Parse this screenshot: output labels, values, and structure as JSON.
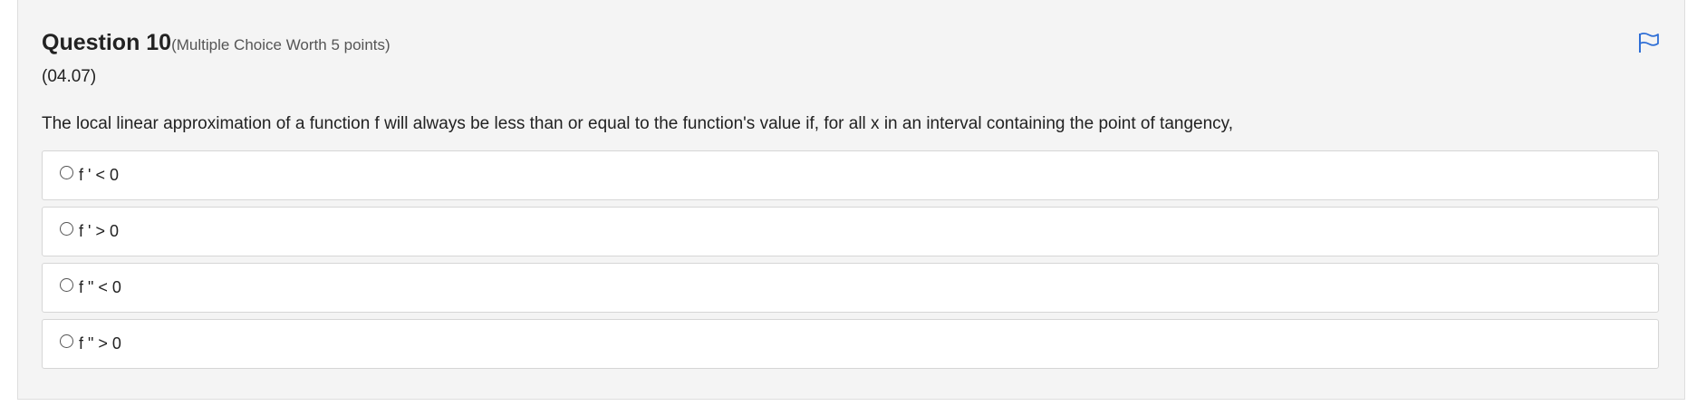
{
  "question": {
    "title": "Question 10",
    "meta": "(Multiple Choice Worth 5 points)",
    "code": "(04.07)",
    "prompt": "The local linear approximation of a function f will always be less than or equal to the function's value if, for all x in an interval containing the point of tangency,",
    "flag_icon": "flag-icon",
    "choices": [
      {
        "label": "f ' < 0",
        "selected": false
      },
      {
        "label": "f ' > 0",
        "selected": false
      },
      {
        "label": "f \" < 0",
        "selected": false
      },
      {
        "label": "f \" > 0",
        "selected": false
      }
    ]
  },
  "colors": {
    "card_background": "#f4f4f4",
    "flag_accent": "#2f6fd6",
    "text": "#222222",
    "meta_text": "#555555"
  }
}
